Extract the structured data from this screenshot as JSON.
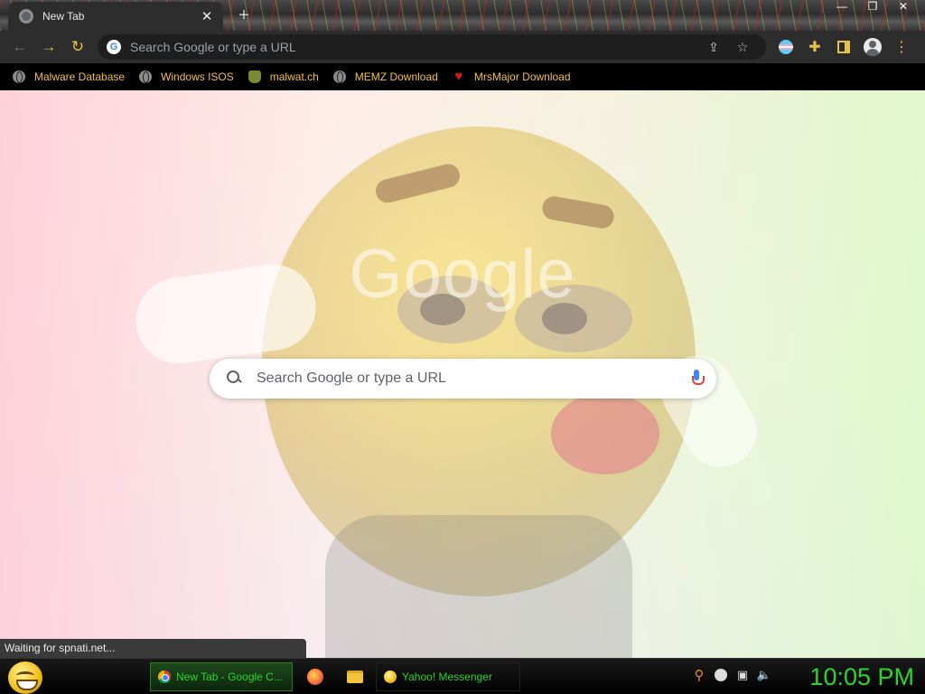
{
  "window": {
    "tab_title": "New Tab",
    "tab_close": "✕",
    "new_tab": "+",
    "minimize": "—",
    "restore": "❐",
    "close": "✕"
  },
  "toolbar": {
    "back": "←",
    "forward": "→",
    "reload": "↻",
    "omnibox_g": "G",
    "omnibox_placeholder": "Search Google or type a URL",
    "share": "⇪",
    "star": "☆",
    "puzzle": "✚",
    "menu": "⋮"
  },
  "bookmarks": [
    {
      "label": "Malware Database",
      "icon": "globe-icon"
    },
    {
      "label": "Windows ISOS",
      "icon": "globe-icon"
    },
    {
      "label": "malwat.ch",
      "icon": "frog-icon"
    },
    {
      "label": "MEMZ Download",
      "icon": "globe-icon"
    },
    {
      "label": "MrsMajor Download",
      "icon": "heart-icon"
    }
  ],
  "ntp": {
    "logo": "Google",
    "search_placeholder": "Search Google or type a URL"
  },
  "status": {
    "text": "Waiting for spnati.net..."
  },
  "taskbar": {
    "items": [
      {
        "label": "New Tab - Google C...",
        "icon": "chrome-icon",
        "active": true
      },
      {
        "label": "Yahoo! Messenger",
        "icon": "yahoo-icon",
        "active": false
      }
    ],
    "quick_launch": [
      "firefox-icon",
      "folder-icon"
    ],
    "tray_icons": [
      "key-icon",
      "minus-circle-icon",
      "network-icon",
      "volume-icon"
    ],
    "clock": "10:05 PM"
  },
  "colors": {
    "accent": "#e8c24a",
    "bookmark_text": "#f0c040",
    "taskbar_text": "#2ad62a",
    "toolbar_bg": "#2d2d2d"
  }
}
